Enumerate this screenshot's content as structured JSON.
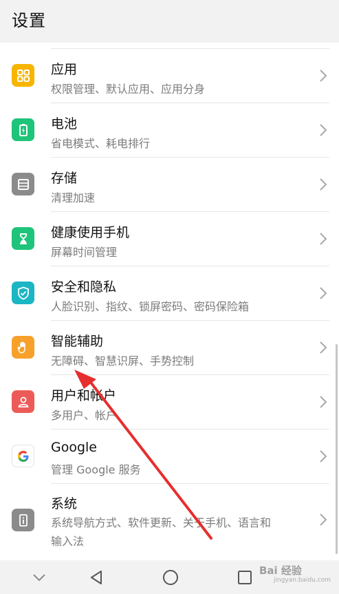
{
  "header": {
    "title": "设置"
  },
  "colors": {
    "apps": "#f7b500",
    "battery": "#1ec47a",
    "storage": "#8b8b8b",
    "health": "#1ec47a",
    "security": "#1bb6c4",
    "assist": "#f7a12b",
    "users": "#ec5b58",
    "google": "#ffffff",
    "system": "#8b8b8b",
    "arrow": "#e62e2e"
  },
  "items": [
    {
      "title": "应用",
      "subtitle": "权限管理、默认应用、应用分身",
      "icon": "apps-grid-icon"
    },
    {
      "title": "电池",
      "subtitle": "省电模式、耗电排行",
      "icon": "battery-icon"
    },
    {
      "title": "存储",
      "subtitle": "清理加速",
      "icon": "storage-icon"
    },
    {
      "title": "健康使用手机",
      "subtitle": "屏幕时间管理",
      "icon": "hourglass-icon"
    },
    {
      "title": "安全和隐私",
      "subtitle": "人脸识别、指纹、锁屏密码、密码保险箱",
      "icon": "shield-check-icon"
    },
    {
      "title": "智能辅助",
      "subtitle": "无障碍、智慧识屏、手势控制",
      "icon": "hand-icon"
    },
    {
      "title": "用户和帐户",
      "subtitle": "多用户、帐户",
      "icon": "user-icon"
    },
    {
      "title": "Google",
      "subtitle": "管理 Google 服务",
      "icon": "google-icon"
    },
    {
      "title": "系统",
      "subtitle": "系统导航方式、软件更新、关于手机、语言和",
      "subtitle2": "输入法",
      "icon": "system-info-icon"
    }
  ],
  "watermark": {
    "text": "Bai 经验",
    "sub": "jingyan.baidu.com"
  }
}
